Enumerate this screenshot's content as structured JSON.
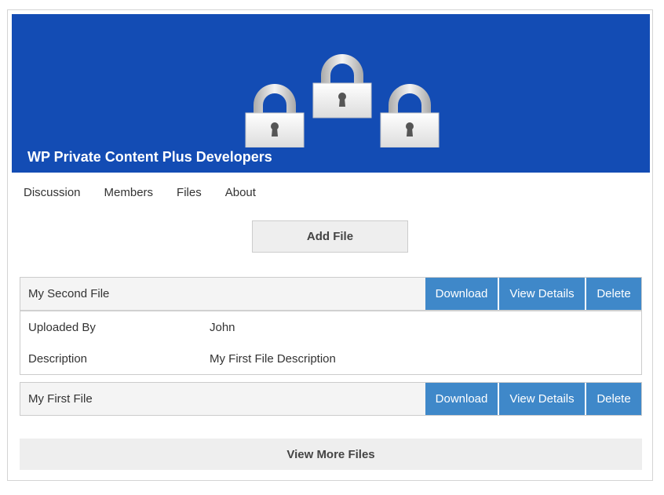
{
  "group": {
    "title": "WP Private Content Plus Developers",
    "banner_color": "#134cb4",
    "banner_icon": "padlock-icons"
  },
  "tabs": [
    {
      "label": "Discussion"
    },
    {
      "label": "Members"
    },
    {
      "label": "Files"
    },
    {
      "label": "About"
    }
  ],
  "add_file_label": "Add File",
  "files": [
    {
      "name": "My Second File",
      "actions": {
        "download": "Download",
        "view": "View Details",
        "delete": "Delete"
      },
      "details": [
        {
          "label": "Uploaded By",
          "value": "John"
        },
        {
          "label": "Description",
          "value": "My First File Description"
        }
      ]
    },
    {
      "name": "My First File",
      "actions": {
        "download": "Download",
        "view": "View Details",
        "delete": "Delete"
      }
    }
  ],
  "view_more_label": "View More Files",
  "colors": {
    "action_button": "#3f88c9",
    "header_bg": "#f4f4f4"
  }
}
